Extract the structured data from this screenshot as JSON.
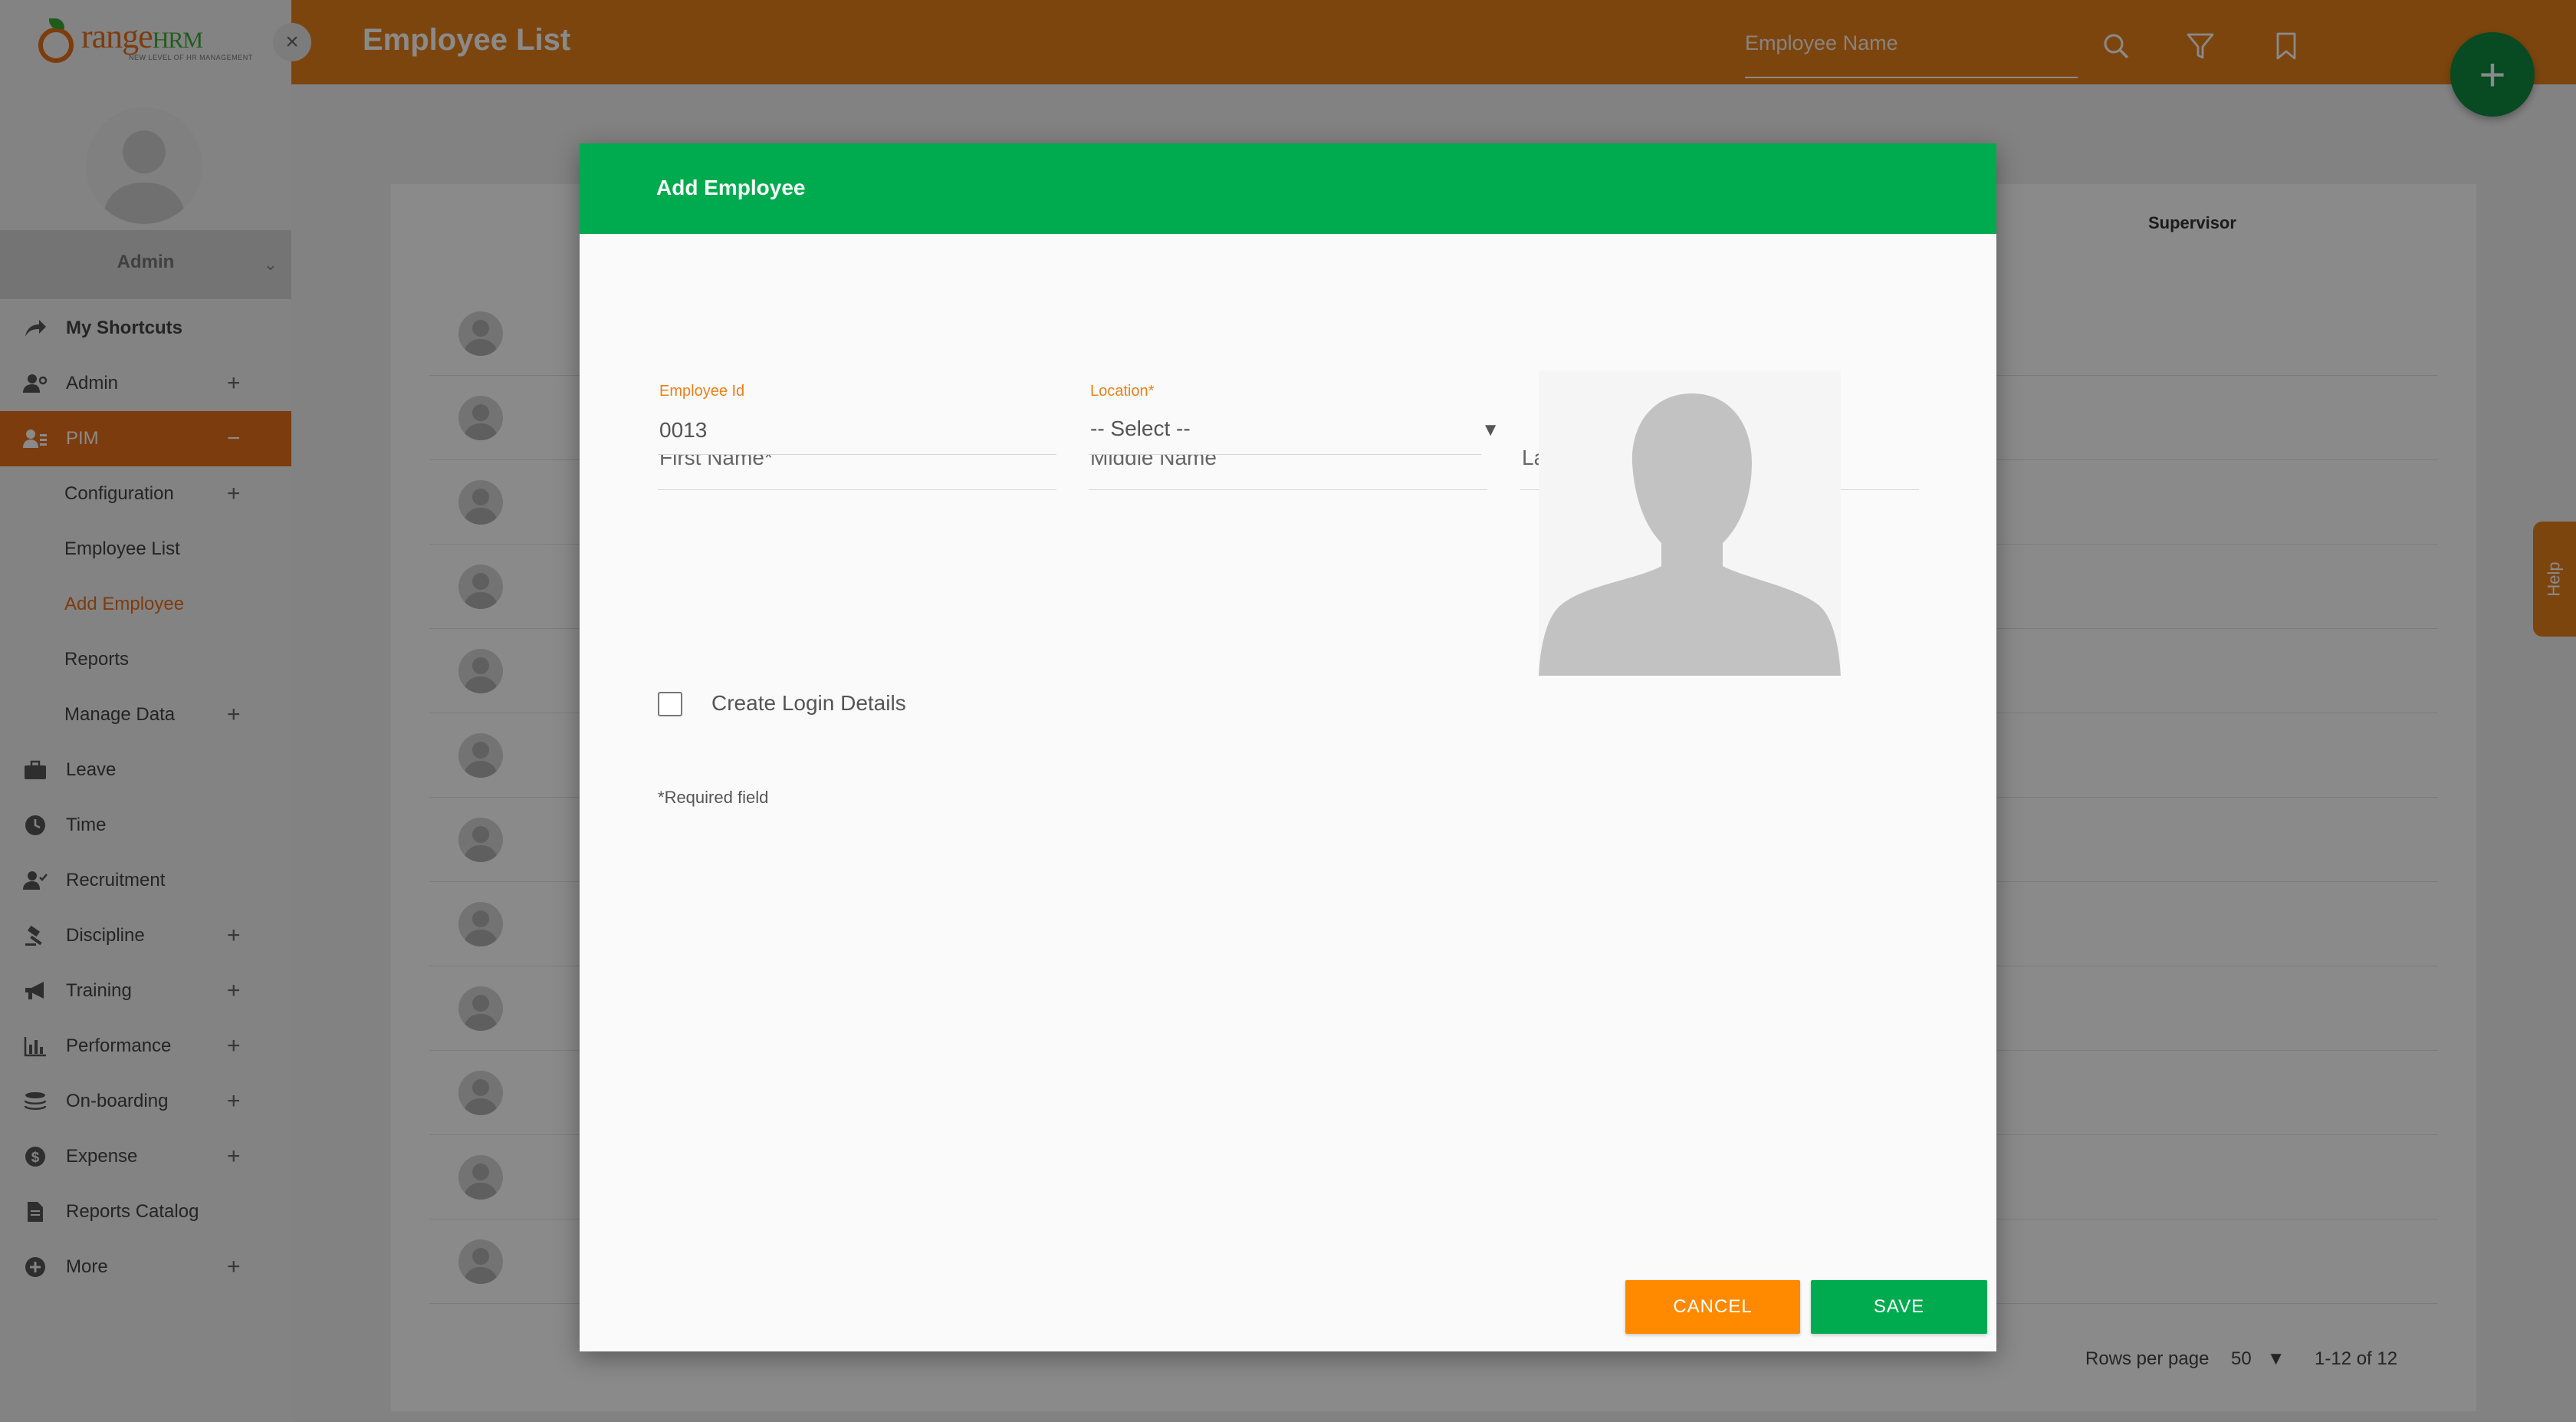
{
  "colors": {
    "brand_orange": "#e8801a",
    "brand_green": "#00ab4f",
    "fab_green": "#0f8a3d",
    "cancel_orange": "#ff8a00"
  },
  "logo": {
    "text_main": "range",
    "text_hrm": "HRM",
    "tagline": "NEW LEVEL OF HR MANAGEMENT"
  },
  "sidebar": {
    "close_icon": "×",
    "user_name": "Admin",
    "menu": [
      {
        "label": "My Shortcuts",
        "icon": "share-icon",
        "plus": ""
      },
      {
        "label": "Admin",
        "icon": "user-cog-icon",
        "plus": "+"
      },
      {
        "label": "PIM",
        "icon": "id-card-icon",
        "plus": "−"
      },
      {
        "label": "Configuration",
        "icon": "",
        "plus": "+"
      },
      {
        "label": "Employee List",
        "icon": "",
        "plus": ""
      },
      {
        "label": "Add Employee",
        "icon": "",
        "plus": ""
      },
      {
        "label": "Reports",
        "icon": "",
        "plus": ""
      },
      {
        "label": "Manage Data",
        "icon": "",
        "plus": "+"
      },
      {
        "label": "Leave",
        "icon": "briefcase-icon",
        "plus": ""
      },
      {
        "label": "Time",
        "icon": "clock-icon",
        "plus": ""
      },
      {
        "label": "Recruitment",
        "icon": "user-check-icon",
        "plus": ""
      },
      {
        "label": "Discipline",
        "icon": "gavel-icon",
        "plus": "+"
      },
      {
        "label": "Training",
        "icon": "megaphone-icon",
        "plus": "+"
      },
      {
        "label": "Performance",
        "icon": "bar-chart-icon",
        "plus": "+"
      },
      {
        "label": "On-boarding",
        "icon": "layers-icon",
        "plus": "+"
      },
      {
        "label": "Expense",
        "icon": "dollar-icon",
        "plus": "+"
      },
      {
        "label": "Reports Catalog",
        "icon": "file-icon",
        "plus": ""
      },
      {
        "label": "More",
        "icon": "plus-circle-icon",
        "plus": "+"
      }
    ]
  },
  "header": {
    "title": "Employee List",
    "search_placeholder": "Employee Name",
    "fab_label": "+"
  },
  "background_list": {
    "column_supervisor": "Supervisor",
    "rows_per_page_label": "Rows per page",
    "rows_per_page_value": "50",
    "pagination": "1-12 of 12",
    "row_count": 12
  },
  "help_tab": "Help",
  "modal": {
    "title": "Add Employee",
    "first_name_label": "First Name",
    "middle_name_label": "Middle Name",
    "last_name_label": "Last Name",
    "required_mark": "*",
    "employee_id_label": "Employee Id",
    "employee_id_value": "0013",
    "location_label": "Location",
    "location_value": "-- Select --",
    "caret": "▼",
    "create_login_label": "Create Login Details",
    "required_note": "Required field",
    "cancel_label": "CANCEL",
    "save_label": "SAVE"
  }
}
